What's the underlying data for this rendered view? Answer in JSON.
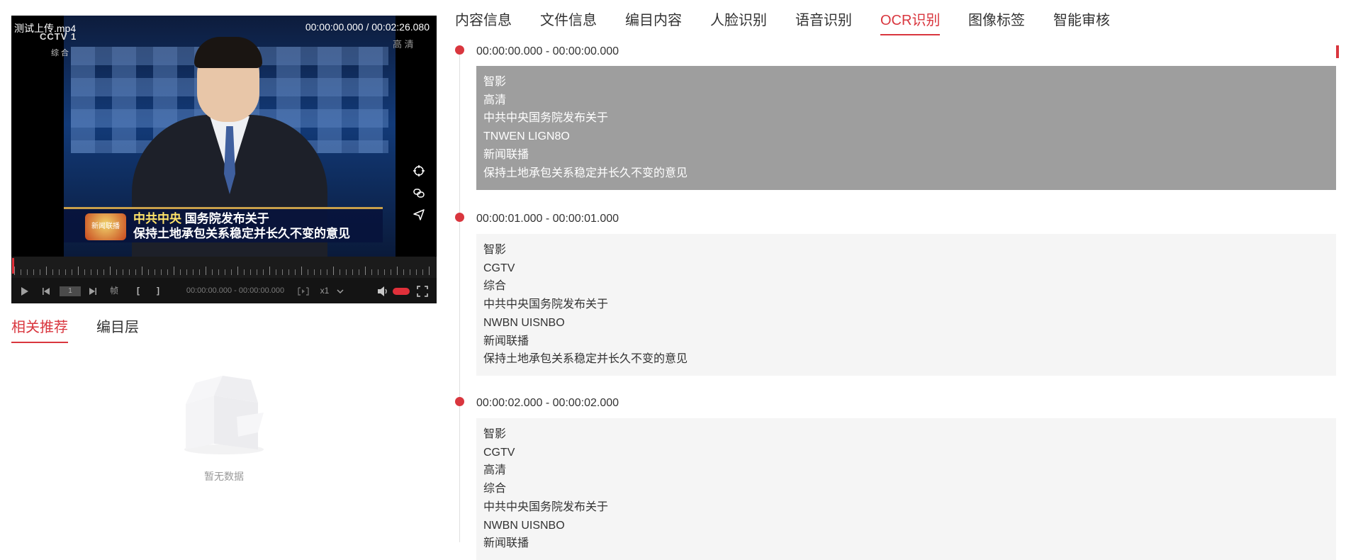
{
  "player": {
    "file_name": "测试上传.mp4",
    "time_display": "00:00:00.000 / 00:02:26.080",
    "channel_logo": "CCTV 1",
    "channel_sub": "综 合",
    "hd_mark": "高 清",
    "caption": {
      "logo_text": "新闻联播",
      "line1_highlight": "中共中央",
      "line1_rest": " 国务院发布关于",
      "line2": "保持土地承包关系稳定并长久不变的意见"
    },
    "controls": {
      "frame_value": "1",
      "frame_label": "帧",
      "mark_in": "[",
      "mark_out": "]",
      "range_time": "00:00:00.000 - 00:00:00.000",
      "speed": "x1"
    },
    "progress": 0
  },
  "left_tabs": [
    {
      "label": "相关推荐",
      "active": true
    },
    {
      "label": "编目层",
      "active": false
    }
  ],
  "empty": {
    "text": "暂无数据"
  },
  "top_tabs": [
    {
      "label": "内容信息",
      "active": false
    },
    {
      "label": "文件信息",
      "active": false
    },
    {
      "label": "编目内容",
      "active": false
    },
    {
      "label": "人脸识别",
      "active": false
    },
    {
      "label": "语音识别",
      "active": false
    },
    {
      "label": "OCR识别",
      "active": true
    },
    {
      "label": "图像标签",
      "active": false
    },
    {
      "label": "智能审核",
      "active": false
    }
  ],
  "segments": [
    {
      "time": "00:00:00.000 - 00:00:00.000",
      "active": true,
      "lines": [
        "智影",
        "高清",
        "中共中央国务院发布关于",
        "TNWEN LIGN8O",
        "新闻联播",
        "保持土地承包关系稳定并长久不变的意见"
      ]
    },
    {
      "time": "00:00:01.000 - 00:00:01.000",
      "active": false,
      "lines": [
        "智影",
        "CGTV",
        "综合",
        "中共中央国务院发布关于",
        "NWBN UISNBO",
        "新闻联播",
        "保持土地承包关系稳定并长久不变的意见"
      ]
    },
    {
      "time": "00:00:02.000 - 00:00:02.000",
      "active": false,
      "lines": [
        "智影",
        "CGTV",
        "高清",
        "综合",
        "中共中央国务院发布关于",
        "NWBN UISNBO",
        "新闻联播"
      ]
    }
  ],
  "colors": {
    "accent": "#d9363e",
    "active_row": "#9e9e9e",
    "row_bg": "#f5f5f5"
  },
  "icons": [
    "play-icon",
    "step-back-icon",
    "step-forward-icon",
    "mark-icon",
    "volume-icon",
    "fullscreen-icon",
    "target-icon",
    "link-icon",
    "send-icon",
    "chevron-down-icon",
    "empty-box-icon"
  ]
}
